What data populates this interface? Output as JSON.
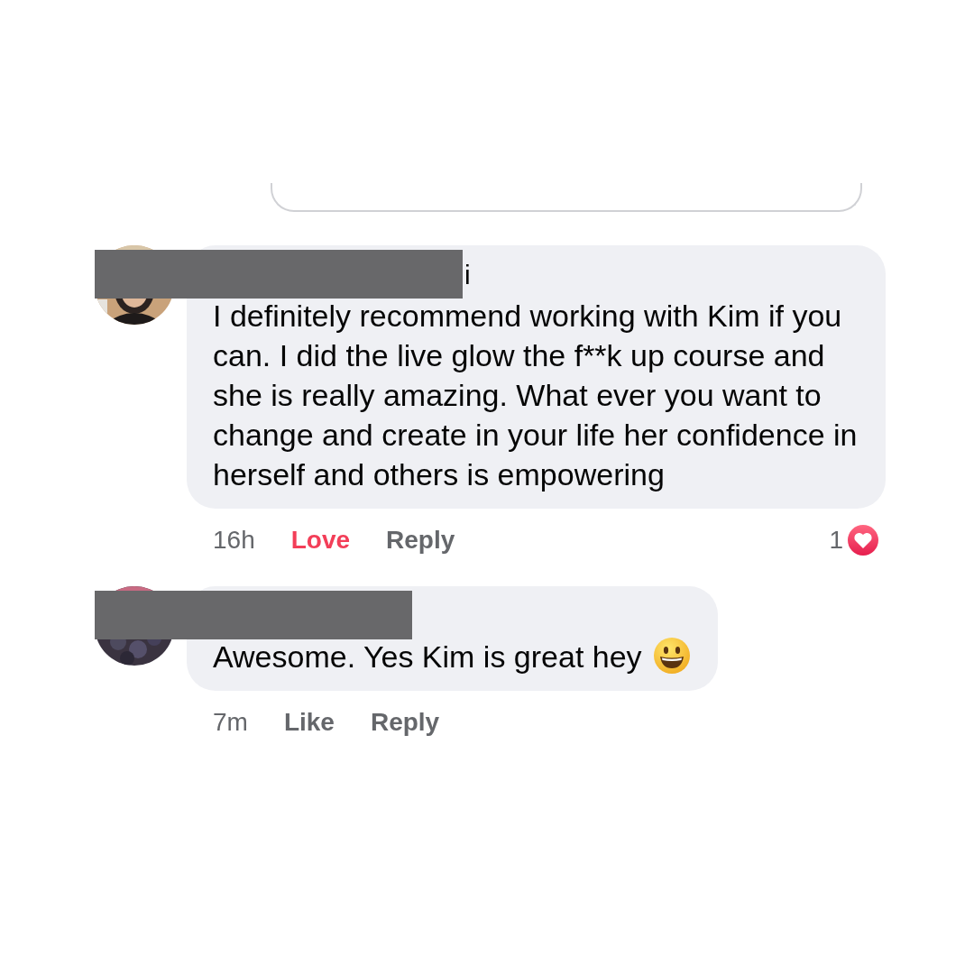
{
  "comments": [
    {
      "author": "i",
      "author_redacted": true,
      "text": "I definitely recommend working with Kim if you can. I did the live glow the f**k up course and she is really amazing. What ever you want to change and create in your life her confidence in herself and others is empowering",
      "trailing_emoji": false,
      "time": "16h",
      "reaction_action": "Love",
      "reacted": true,
      "reply": "Reply",
      "reaction_count": "1"
    },
    {
      "author_redacted": true,
      "text": "Awesome. Yes Kim is great hey",
      "trailing_emoji": true,
      "time": "7m",
      "reaction_action": "Like",
      "reacted": false,
      "reply": "Reply"
    }
  ]
}
